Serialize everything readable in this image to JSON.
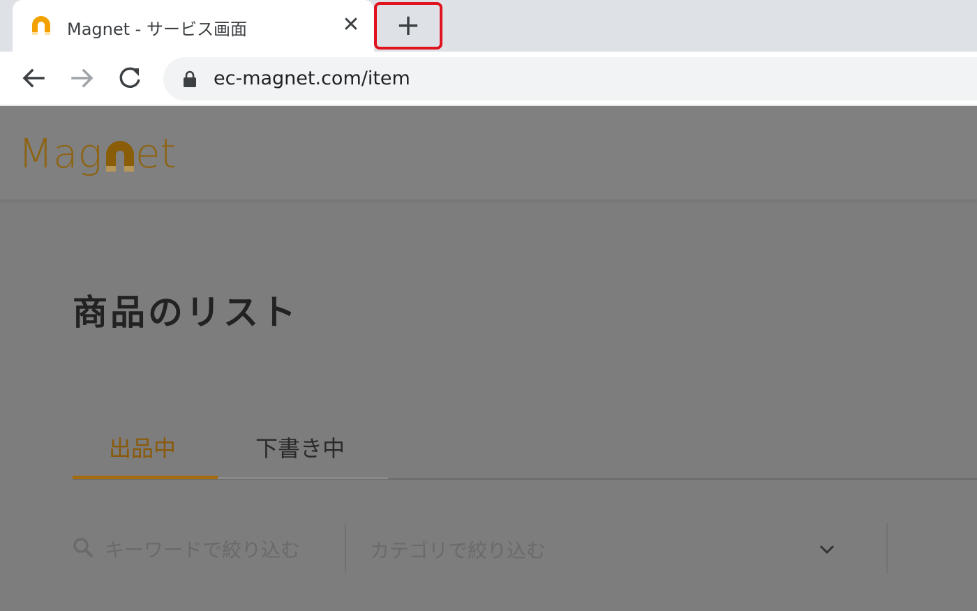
{
  "browser": {
    "tab": {
      "title": "Magnet - サービス画面",
      "favicon_icon": "magnet-icon",
      "close_icon": "close-icon",
      "close_glyph": "✕"
    },
    "new_tab": {
      "glyph": "+",
      "icon": "plus-icon"
    },
    "toolbar": {
      "back_icon": "arrow-left-icon",
      "forward_icon": "arrow-right-icon",
      "reload_icon": "reload-icon",
      "lock_icon": "lock-icon",
      "url": "ec-magnet.com/item"
    }
  },
  "site": {
    "logo": {
      "text_left": "Mag",
      "text_right": "et",
      "icon": "magnet-logo-icon"
    },
    "page_title": "商品のリスト",
    "tabs": [
      {
        "label": "出品中",
        "active": true
      },
      {
        "label": "下書き中",
        "active": false
      }
    ],
    "filters": {
      "search_placeholder": "キーワードで絞り込む",
      "category_placeholder": "カテゴリで絞り込む"
    }
  },
  "colors": {
    "accent": "#a66a10",
    "highlight_border": "#e0141e",
    "overlay": "#7d7d7d"
  }
}
